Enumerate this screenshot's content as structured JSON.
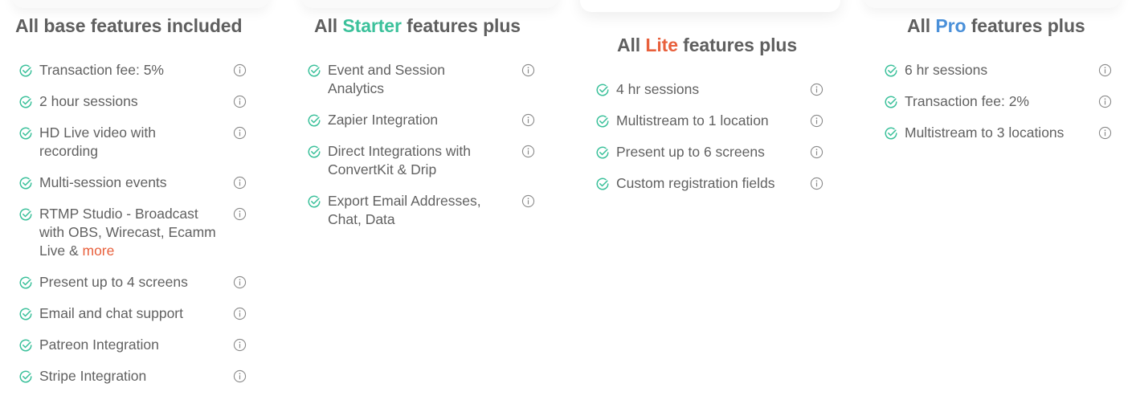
{
  "colors": {
    "check": "#3cc19b",
    "starter": "#3cc19b",
    "lite": "#e8603c",
    "pro": "#4a90d9",
    "more_link": "#e8603c",
    "text": "#5f5f5f",
    "info_icon": "#8a8a8a"
  },
  "columns": [
    {
      "heading_prefix": "All base features included",
      "heading_accent": "",
      "heading_suffix": "",
      "features": [
        {
          "text": "Transaction fee: 5%",
          "icon": "check-circle-icon",
          "info": "info-icon"
        },
        {
          "text": "2 hour sessions",
          "icon": "check-circle-icon",
          "info": "info-icon"
        },
        {
          "text": "HD Live video with recording",
          "icon": "check-circle-icon",
          "info": "info-icon"
        },
        {
          "text": "Multi-session events",
          "icon": "check-circle-icon",
          "info": "info-icon"
        },
        {
          "text": "RTMP Studio - Broadcast with OBS, Wirecast, Ecamm Live & ",
          "link": "more",
          "icon": "check-circle-icon",
          "info": "info-icon"
        },
        {
          "text": "Present up to 4 screens",
          "icon": "check-circle-icon",
          "info": "info-icon"
        },
        {
          "text": "Email and chat support",
          "icon": "check-circle-icon",
          "info": "info-icon"
        },
        {
          "text": "Patreon Integration",
          "icon": "check-circle-icon",
          "info": "info-icon"
        },
        {
          "text": "Stripe Integration",
          "icon": "check-circle-icon",
          "info": "info-icon"
        }
      ]
    },
    {
      "heading_prefix": "All ",
      "heading_accent": "Starter",
      "heading_suffix": " features plus",
      "features": [
        {
          "text": "Event and Session Analytics",
          "icon": "check-circle-icon",
          "info": "info-icon"
        },
        {
          "text": "Zapier Integration",
          "icon": "check-circle-icon",
          "info": "info-icon"
        },
        {
          "text": "Direct Integrations with ConvertKit & Drip",
          "icon": "check-circle-icon",
          "info": "info-icon"
        },
        {
          "text": "Export Email Addresses, Chat, Data",
          "icon": "check-circle-icon",
          "info": "info-icon"
        }
      ]
    },
    {
      "heading_prefix": "All ",
      "heading_accent": "Lite",
      "heading_suffix": " features plus",
      "features": [
        {
          "text": "4 hr sessions",
          "icon": "check-circle-icon",
          "info": "info-icon"
        },
        {
          "text": "Multistream to 1 location",
          "icon": "check-circle-icon",
          "info": "info-icon"
        },
        {
          "text": "Present up to 6 screens",
          "icon": "check-circle-icon",
          "info": "info-icon"
        },
        {
          "text": "Custom registration fields",
          "icon": "check-circle-icon",
          "info": "info-icon"
        }
      ]
    },
    {
      "heading_prefix": "All ",
      "heading_accent": "Pro",
      "heading_suffix": " features plus",
      "features": [
        {
          "text": "6 hr sessions",
          "icon": "check-circle-icon",
          "info": "info-icon"
        },
        {
          "text": "Transaction fee: 2%",
          "icon": "check-circle-icon",
          "info": "info-icon"
        },
        {
          "text": "Multistream to 3 locations",
          "icon": "check-circle-icon",
          "info": "info-icon"
        }
      ]
    }
  ]
}
